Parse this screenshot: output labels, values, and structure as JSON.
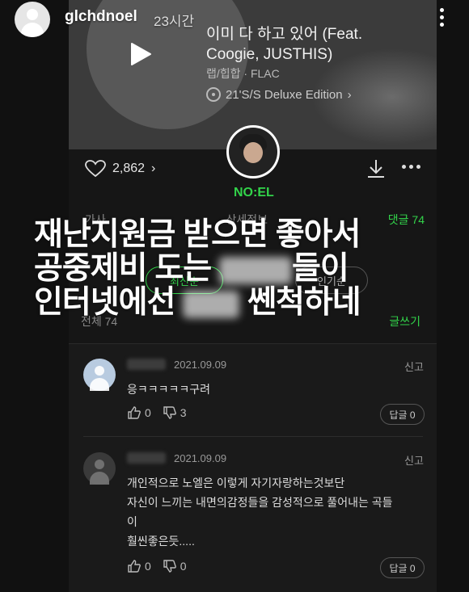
{
  "story": {
    "username": "glchdnoel",
    "time": "23시간"
  },
  "track": {
    "title": "이미 다 하고 있어 (Feat. Coogie, JUSTHIS)",
    "genre": "랩/힙합 · FLAC",
    "album": "21'S/S Deluxe Edition"
  },
  "song_page": {
    "like_count": "2,862",
    "artist": "NO:EL",
    "tabs": [
      "가사",
      "상세정보",
      "댓글 74"
    ],
    "filter_active": "최신순",
    "filter_other": "인기순",
    "total_label": "전체 74",
    "write_label": "글쓰기"
  },
  "caption": {
    "line1": "재난지원금 받으면 좋아서",
    "line2a": "공중제비 도는 ",
    "line2b": "들이",
    "line3a": "인터넷에선 ",
    "line3b": " 쎈척하네"
  },
  "comments": [
    {
      "date": "2021.09.09",
      "report": "신고",
      "text": "응ㅋㅋㅋㅋㅋ구려",
      "likes": "0",
      "dislikes": "3",
      "reply": "답글 0"
    },
    {
      "date": "2021.09.09",
      "report": "신고",
      "text_lines": [
        "개인적으로 노엘은 이렇게 자기자랑하는것보단",
        "자신이 느끼는 내면의감정들을 감성적으로 풀어내는 곡들",
        "이",
        "훨씬좋은듯....."
      ],
      "likes": "0",
      "dislikes": "0",
      "reply": "답글 0"
    }
  ],
  "colors": {
    "accent": "#32d44a",
    "background": "#111111"
  }
}
